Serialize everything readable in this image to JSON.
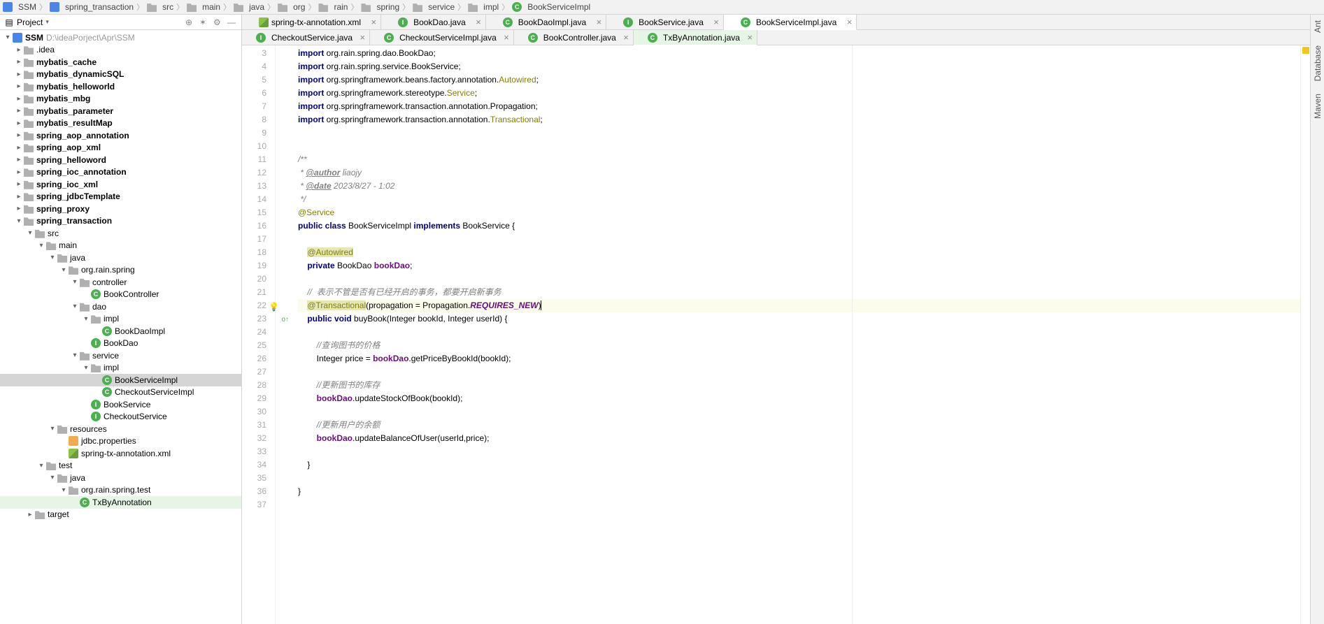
{
  "breadcrumbs": [
    "SSM",
    "spring_transaction",
    "src",
    "main",
    "java",
    "org",
    "rain",
    "spring",
    "service",
    "impl",
    "BookServiceImpl"
  ],
  "breadcrumb_types": [
    "module",
    "module",
    "folder",
    "folder",
    "folder",
    "folder",
    "folder",
    "folder",
    "folder",
    "folder",
    "class"
  ],
  "project_dropdown": "Project",
  "tree_root": {
    "label": "SSM",
    "path": "D:\\ideaPorject\\Apr\\SSM"
  },
  "folders_closed": [
    ".idea",
    "mybatis_cache",
    "mybatis_dynamicSQL",
    "mybatis_helloworld",
    "mybatis_mbg",
    "mybatis_parameter",
    "mybatis_resultMap",
    "spring_aop_annotation",
    "spring_aop_xml",
    "spring_helloword",
    "spring_ioc_annotation",
    "spring_ioc_xml",
    "spring_jdbcTemplate",
    "spring_proxy"
  ],
  "spring_transaction": {
    "label": "spring_transaction",
    "children": {
      "src": "src",
      "main": "main",
      "java": "java",
      "pkg": "org.rain.spring",
      "controller": {
        "label": "controller",
        "files": [
          "BookController"
        ]
      },
      "dao": {
        "label": "dao",
        "impl": "impl",
        "impl_files": [
          "BookDaoImpl"
        ],
        "files": [
          "BookDao"
        ]
      },
      "service": {
        "label": "service",
        "impl": "impl",
        "impl_files": [
          "BookServiceImpl",
          "CheckoutServiceImpl"
        ],
        "files": [
          "BookService",
          "CheckoutService"
        ]
      },
      "resources": {
        "label": "resources",
        "files": [
          "jdbc.properties",
          "spring-tx-annotation.xml"
        ]
      },
      "test": {
        "label": "test",
        "java": "java",
        "pkg": "org.rain.spring.test",
        "file": "TxByAnnotation"
      },
      "target": "target"
    }
  },
  "tabs_row1": [
    {
      "label": "spring-tx-annotation.xml",
      "type": "xml"
    },
    {
      "label": "BookDao.java",
      "type": "i"
    },
    {
      "label": "BookDaoImpl.java",
      "type": "c"
    },
    {
      "label": "BookService.java",
      "type": "i"
    },
    {
      "label": "BookServiceImpl.java",
      "type": "c",
      "active": true
    }
  ],
  "tabs_row2": [
    {
      "label": "CheckoutService.java",
      "type": "i"
    },
    {
      "label": "CheckoutServiceImpl.java",
      "type": "c"
    },
    {
      "label": "BookController.java",
      "type": "c"
    },
    {
      "label": "TxByAnnotation.java",
      "type": "c",
      "active": true,
      "green": true
    }
  ],
  "code": {
    "first_line": 3,
    "lines": [
      {
        "n": 3,
        "t": "import org.rain.spring.dao.BookDao;",
        "kind": "import"
      },
      {
        "n": 4,
        "t": "import org.rain.spring.service.BookService;",
        "kind": "import"
      },
      {
        "n": 5,
        "t": "import org.springframework.beans.factory.annotation.Autowired;",
        "kind": "import",
        "tail_ann": "Autowired"
      },
      {
        "n": 6,
        "t": "import org.springframework.stereotype.Service;",
        "kind": "import",
        "tail_ann": "Service"
      },
      {
        "n": 7,
        "t": "import org.springframework.transaction.annotation.Propagation;",
        "kind": "import"
      },
      {
        "n": 8,
        "t": "import org.springframework.transaction.annotation.Transactional;",
        "kind": "import",
        "tail_ann": "Transactional"
      },
      {
        "n": 9,
        "t": ""
      },
      {
        "n": 10,
        "t": ""
      },
      {
        "n": 11,
        "t": "/**",
        "kind": "cmt"
      },
      {
        "n": 12,
        "t": " * @author liaojy",
        "kind": "doc",
        "tag": "@author",
        "rest": " liaojy"
      },
      {
        "n": 13,
        "t": " * @date 2023/8/27 - 1:02",
        "kind": "doc",
        "tag": "@date",
        "rest": " 2023/8/27 - 1:02"
      },
      {
        "n": 14,
        "t": " */",
        "kind": "cmt"
      },
      {
        "n": 15,
        "t": "@Service",
        "kind": "ann"
      },
      {
        "n": 16,
        "t": "public class BookServiceImpl implements BookService {",
        "kind": "classdecl"
      },
      {
        "n": 17,
        "t": ""
      },
      {
        "n": 18,
        "t": "    @Autowired",
        "kind": "ann_bg"
      },
      {
        "n": 19,
        "t": "    private BookDao bookDao;",
        "kind": "field"
      },
      {
        "n": 20,
        "t": ""
      },
      {
        "n": 21,
        "t": "    //  表示不管是否有已经开启的事务，都要开启新事务",
        "kind": "cmt"
      },
      {
        "n": 22,
        "t": "    @Transactional(propagation = Propagation.REQUIRES_NEW)",
        "kind": "trans_line",
        "hl": true,
        "bulb": true
      },
      {
        "n": 23,
        "t": "    public void buyBook(Integer bookId, Integer userId) {",
        "kind": "method",
        "ovr": true
      },
      {
        "n": 24,
        "t": ""
      },
      {
        "n": 25,
        "t": "        //查询图书的价格",
        "kind": "cmt"
      },
      {
        "n": 26,
        "t": "        Integer price = bookDao.getPriceByBookId(bookId);",
        "kind": "stmt1"
      },
      {
        "n": 27,
        "t": ""
      },
      {
        "n": 28,
        "t": "        //更新图书的库存",
        "kind": "cmt"
      },
      {
        "n": 29,
        "t": "        bookDao.updateStockOfBook(bookId);",
        "kind": "stmt2"
      },
      {
        "n": 30,
        "t": ""
      },
      {
        "n": 31,
        "t": "        //更新用户的余额",
        "kind": "cmt"
      },
      {
        "n": 32,
        "t": "        bookDao.updateBalanceOfUser(userId,price);",
        "kind": "stmt3"
      },
      {
        "n": 33,
        "t": ""
      },
      {
        "n": 34,
        "t": "    }"
      },
      {
        "n": 35,
        "t": ""
      },
      {
        "n": 36,
        "t": "}"
      },
      {
        "n": 37,
        "t": ""
      }
    ]
  },
  "right_tools": [
    "Ant",
    "Database",
    "Maven"
  ]
}
